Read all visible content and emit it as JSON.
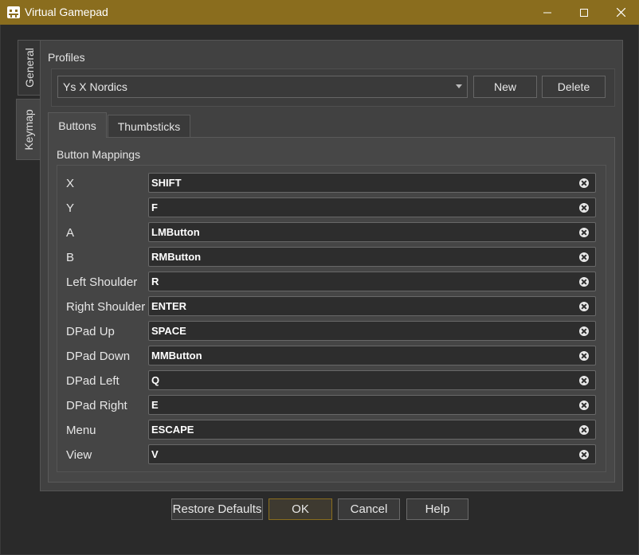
{
  "window": {
    "title": "Virtual Gamepad"
  },
  "side_tabs": [
    {
      "label": "General"
    },
    {
      "label": "Keymap"
    }
  ],
  "profiles": {
    "label": "Profiles",
    "selected": "Ys X Nordics",
    "new_label": "New",
    "delete_label": "Delete"
  },
  "tabs": [
    {
      "label": "Buttons"
    },
    {
      "label": "Thumbsticks"
    }
  ],
  "mappings": {
    "title": "Button Mappings",
    "rows": [
      {
        "label": "X",
        "value": "SHIFT"
      },
      {
        "label": "Y",
        "value": "F"
      },
      {
        "label": "A",
        "value": "LMButton"
      },
      {
        "label": "B",
        "value": "RMButton"
      },
      {
        "label": "Left Shoulder",
        "value": "R"
      },
      {
        "label": "Right Shoulder",
        "value": "ENTER"
      },
      {
        "label": "DPad Up",
        "value": "SPACE"
      },
      {
        "label": "DPad Down",
        "value": "MMButton"
      },
      {
        "label": "DPad Left",
        "value": "Q"
      },
      {
        "label": "DPad Right",
        "value": "E"
      },
      {
        "label": "Menu",
        "value": "ESCAPE"
      },
      {
        "label": "View",
        "value": "V"
      }
    ]
  },
  "footer": {
    "restore_label": "Restore Defaults",
    "ok_label": "OK",
    "cancel_label": "Cancel",
    "help_label": "Help"
  },
  "colors": {
    "titlebar": "#8a6d1e",
    "background": "#2a2a2a",
    "panel": "#414141",
    "field": "#2d2d2d"
  }
}
